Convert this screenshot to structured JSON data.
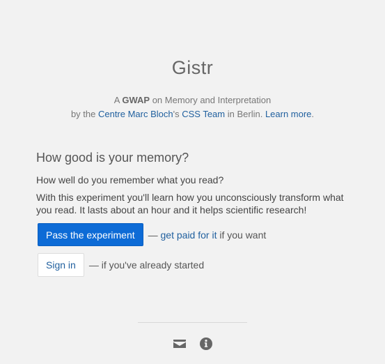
{
  "header": {
    "title": "Gistr",
    "line1_prefix": "A ",
    "line1_bold": "GWAP",
    "line1_suffix": " on Memory and Interpretation",
    "line2_prefix": "by the ",
    "line2_link_org": "Centre Marc Bloch",
    "line2_possessive": "'s ",
    "line2_link_team": "CSS Team",
    "line2_middle": " in Berlin. ",
    "line2_link_more": "Learn more",
    "line2_end": "."
  },
  "intro": {
    "heading": "How good is your memory?",
    "question": "How well do you remember what you read?",
    "description": "With this experiment you'll learn how you unconsciously transform what you read. It lasts about an hour and it helps scientific research!"
  },
  "actions": {
    "pass_label": "Pass the experiment",
    "pass_dash": "— ",
    "paid_link": "get paid for it",
    "paid_suffix": " if you want",
    "signin_label": "Sign in",
    "signin_suffix": "— if you've already started"
  },
  "footer": {
    "icons": [
      "envelope-icon",
      "info-circle-icon"
    ]
  },
  "colors": {
    "background": "#f2f2f2",
    "primary_button": "#0d6bd6",
    "link": "#1f5f9e",
    "footer_icon": "#666666"
  }
}
